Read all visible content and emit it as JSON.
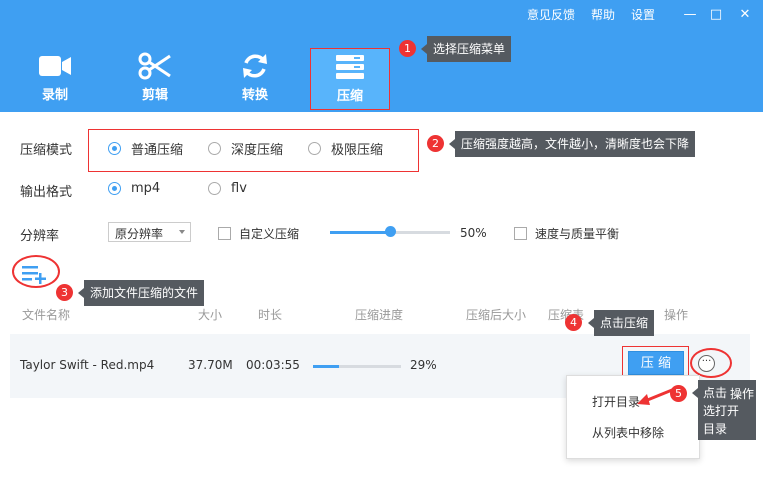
{
  "window": {
    "links": [
      "意见反馈",
      "帮助",
      "设置"
    ],
    "controls": {
      "minimize": "—",
      "maximize": "□",
      "close": "✕"
    }
  },
  "tabs": [
    {
      "label": "录制",
      "icon": "video-camera-icon"
    },
    {
      "label": "剪辑",
      "icon": "scissors-icon"
    },
    {
      "label": "转换",
      "icon": "refresh-icon"
    },
    {
      "label": "压缩",
      "icon": "compress-icon",
      "active": true
    }
  ],
  "compress_mode": {
    "label": "压缩模式",
    "options": [
      "普通压缩",
      "深度压缩",
      "极限压缩"
    ],
    "selected": "普通压缩"
  },
  "output_format": {
    "label": "输出格式",
    "options": [
      "mp4",
      "flv"
    ],
    "selected": "mp4"
  },
  "resolution": {
    "label": "分辨率",
    "value": "原分辨率",
    "custom_label": "自定义压缩",
    "quality_value": "50%",
    "quality_fraction": 0.5,
    "balance_label": "速度与质量平衡"
  },
  "table": {
    "headers": [
      "文件名称",
      "大小",
      "时长",
      "压缩进度",
      "压缩后大小",
      "压缩表",
      "操作"
    ],
    "row": {
      "name": "Taylor Swift - Red.mp4",
      "size": "37.70M",
      "duration": "00:03:55",
      "progress_text": "29%",
      "progress_fraction": 0.29,
      "action": "压 缩",
      "more": "···"
    }
  },
  "menu": {
    "items": [
      "打开目录",
      "从列表中移除"
    ]
  },
  "callouts": [
    {
      "num": "1",
      "text": "选择压缩菜单"
    },
    {
      "num": "2",
      "text": "压缩强度越高，文件越小，清晰度也会下降"
    },
    {
      "num": "3",
      "text": "添加文件压缩的文件"
    },
    {
      "num": "4",
      "text": "点击压缩"
    },
    {
      "num": "5",
      "text": "点击…选打开目录",
      "lines": [
        "点击",
        "选打开",
        "目录"
      ],
      "overlay": "操作"
    }
  ],
  "colors": {
    "accent": "#3f9ff2",
    "callout_red": "#e33333",
    "tip_bg": "#555a60"
  }
}
